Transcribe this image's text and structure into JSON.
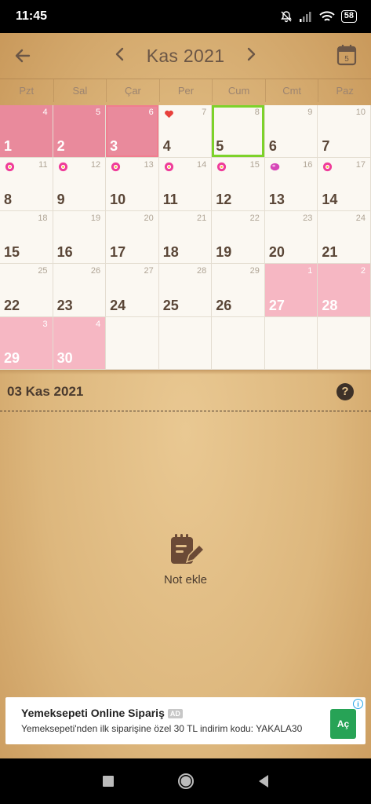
{
  "status_bar": {
    "time": "11:45",
    "battery": "58"
  },
  "header": {
    "month_title": "Kas 2021",
    "prev_icon": "chevron-left-icon",
    "next_icon": "chevron-right-icon",
    "calendar_badge": "5"
  },
  "weekdays": [
    "Pzt",
    "Sal",
    "Çar",
    "Per",
    "Cum",
    "Cmt",
    "Paz"
  ],
  "calendar": {
    "rows": [
      [
        {
          "day": "1",
          "cycle": "4",
          "state": "period"
        },
        {
          "day": "2",
          "cycle": "5",
          "state": "period"
        },
        {
          "day": "3",
          "cycle": "6",
          "state": "period-selected"
        },
        {
          "day": "4",
          "cycle": "7",
          "state": "normal",
          "marker": "heart"
        },
        {
          "day": "5",
          "cycle": "8",
          "state": "today"
        },
        {
          "day": "6",
          "cycle": "9",
          "state": "normal"
        },
        {
          "day": "7",
          "cycle": "10",
          "state": "normal"
        }
      ],
      [
        {
          "day": "8",
          "cycle": "11",
          "state": "normal",
          "marker": "flower"
        },
        {
          "day": "9",
          "cycle": "12",
          "state": "normal",
          "marker": "flower"
        },
        {
          "day": "10",
          "cycle": "13",
          "state": "normal",
          "marker": "flower"
        },
        {
          "day": "11",
          "cycle": "14",
          "state": "normal",
          "marker": "flower"
        },
        {
          "day": "12",
          "cycle": "15",
          "state": "normal",
          "marker": "flower"
        },
        {
          "day": "13",
          "cycle": "16",
          "state": "normal",
          "marker": "ovulation"
        },
        {
          "day": "14",
          "cycle": "17",
          "state": "normal",
          "marker": "flower"
        }
      ],
      [
        {
          "day": "15",
          "cycle": "18",
          "state": "normal"
        },
        {
          "day": "16",
          "cycle": "19",
          "state": "normal"
        },
        {
          "day": "17",
          "cycle": "20",
          "state": "normal"
        },
        {
          "day": "18",
          "cycle": "21",
          "state": "normal"
        },
        {
          "day": "19",
          "cycle": "22",
          "state": "normal"
        },
        {
          "day": "20",
          "cycle": "23",
          "state": "normal"
        },
        {
          "day": "21",
          "cycle": "24",
          "state": "normal"
        }
      ],
      [
        {
          "day": "22",
          "cycle": "25",
          "state": "normal"
        },
        {
          "day": "23",
          "cycle": "26",
          "state": "normal"
        },
        {
          "day": "24",
          "cycle": "27",
          "state": "normal"
        },
        {
          "day": "25",
          "cycle": "28",
          "state": "normal"
        },
        {
          "day": "26",
          "cycle": "29",
          "state": "normal"
        },
        {
          "day": "27",
          "cycle": "1",
          "state": "predicted"
        },
        {
          "day": "28",
          "cycle": "2",
          "state": "predicted"
        }
      ],
      [
        {
          "day": "29",
          "cycle": "3",
          "state": "predicted"
        },
        {
          "day": "30",
          "cycle": "4",
          "state": "predicted"
        },
        {
          "day": "",
          "cycle": "",
          "state": "empty"
        },
        {
          "day": "",
          "cycle": "",
          "state": "empty"
        },
        {
          "day": "",
          "cycle": "",
          "state": "empty"
        },
        {
          "day": "",
          "cycle": "",
          "state": "empty"
        },
        {
          "day": "",
          "cycle": "",
          "state": "empty"
        }
      ]
    ]
  },
  "note_panel": {
    "date": "03 Kas 2021",
    "help_label": "?",
    "add_note_label": "Not ekle"
  },
  "ad": {
    "title": "Yemeksepeti Online Sipariş",
    "badge": "AD",
    "description": "Yemeksepeti'nden ilk siparişine özel 30 TL indirim kodu: YAKALA30",
    "button_label": "Aç",
    "info_label": "i"
  },
  "colors": {
    "period": "#e98a9c",
    "predicted": "#f6b7c3",
    "today_border": "#7dd22b",
    "selected_border": "#f07d8f",
    "ad_button": "#27a356"
  }
}
